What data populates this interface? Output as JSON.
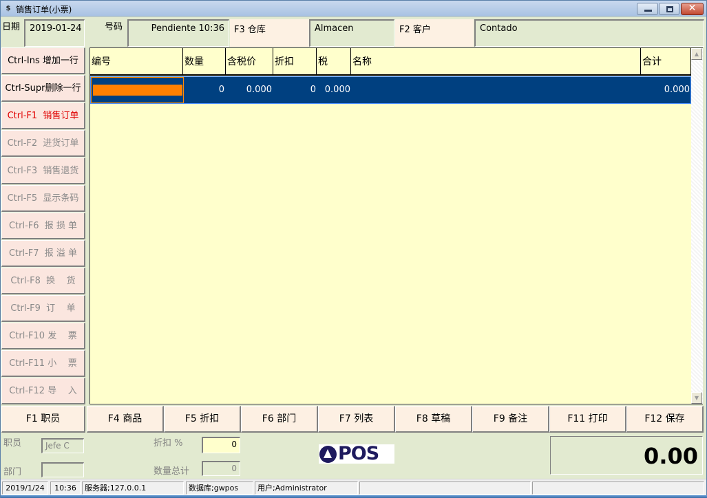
{
  "window": {
    "title": "销售订单(小票)",
    "app_icon": "$",
    "controls": {
      "minimize": "minimize",
      "maximize": "maximize",
      "close": "✕"
    }
  },
  "header": {
    "date_label": "日期",
    "date_value": "2019-01-24",
    "number_label": "号码",
    "number_value": "Pendiente 10:36",
    "warehouse_label": "F3 仓库",
    "warehouse_value": "Almacen",
    "customer_label": "F2 客户",
    "customer_value": "Contado"
  },
  "commands": [
    {
      "label": "Ctrl-Ins 增加一行",
      "state": "enabled"
    },
    {
      "label": "Ctrl-Supr删除一行",
      "state": "enabled"
    },
    {
      "label": "Ctrl-F1  销售订单",
      "state": "active"
    },
    {
      "label": "Ctrl-F2  进货订单",
      "state": "disabled"
    },
    {
      "label": "Ctrl-F3  销售退货",
      "state": "disabled"
    },
    {
      "label": "Ctrl-F5  显示条码",
      "state": "disabled"
    },
    {
      "label": "Ctrl-F6  报 损 单",
      "state": "disabled"
    },
    {
      "label": "Ctrl-F7  报 溢 单",
      "state": "disabled"
    },
    {
      "label": "Ctrl-F8  换    货",
      "state": "disabled"
    },
    {
      "label": "Ctrl-F9  订    单",
      "state": "disabled"
    },
    {
      "label": "Ctrl-F10 发    票",
      "state": "disabled"
    },
    {
      "label": "Ctrl-F11 小    票",
      "state": "disabled"
    },
    {
      "label": "Ctrl-F12 导    入",
      "state": "disabled"
    }
  ],
  "grid": {
    "columns": [
      "编号",
      "数量",
      "含税价",
      "折扣",
      "税",
      "名称",
      "合计"
    ],
    "rows": [
      {
        "code": "",
        "qty": "0",
        "price": "0.000",
        "discount": "0",
        "tax": "0.000",
        "name": "",
        "total": "0.000"
      }
    ]
  },
  "function_keys": [
    "F1 职员",
    "F4 商品",
    "F5 折扣",
    "F6 部门",
    "F7 列表",
    "F8 草稿",
    "F9 备注",
    "F11 打印",
    "F12 保存"
  ],
  "footer": {
    "employee_label": "职员",
    "employee_value": "Jefe   C",
    "department_label": "部门",
    "department_value": "",
    "discount_label": "折扣 %",
    "discount_value": "0",
    "qty_total_label": "数量总计",
    "qty_total_value": "0",
    "logo_text": "POS",
    "grand_total": "0.00"
  },
  "statusbar": {
    "date": "2019/1/24",
    "time": "10:36",
    "server": "服务器;127.0.0.1",
    "database": "数据库;gwpos",
    "user": "用户;Administrator",
    "extra1": "",
    "extra2": ""
  },
  "colors": {
    "selected_row": "#004080",
    "edit_bar": "#ff8000",
    "grid_bg": "#ffffcc",
    "active_command": "#e00000",
    "logo": "#1e1a5e"
  }
}
